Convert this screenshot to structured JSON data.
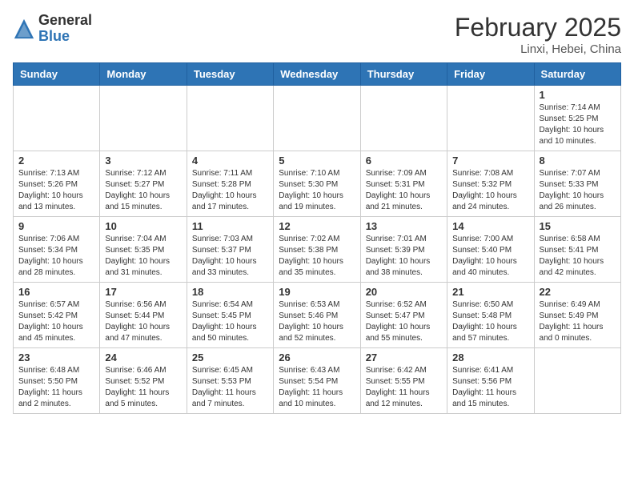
{
  "logo": {
    "general": "General",
    "blue": "Blue"
  },
  "title": {
    "month_year": "February 2025",
    "location": "Linxi, Hebei, China"
  },
  "weekdays": [
    "Sunday",
    "Monday",
    "Tuesday",
    "Wednesday",
    "Thursday",
    "Friday",
    "Saturday"
  ],
  "weeks": [
    [
      {
        "day": "",
        "info": ""
      },
      {
        "day": "",
        "info": ""
      },
      {
        "day": "",
        "info": ""
      },
      {
        "day": "",
        "info": ""
      },
      {
        "day": "",
        "info": ""
      },
      {
        "day": "",
        "info": ""
      },
      {
        "day": "1",
        "info": "Sunrise: 7:14 AM\nSunset: 5:25 PM\nDaylight: 10 hours\nand 10 minutes."
      }
    ],
    [
      {
        "day": "2",
        "info": "Sunrise: 7:13 AM\nSunset: 5:26 PM\nDaylight: 10 hours\nand 13 minutes."
      },
      {
        "day": "3",
        "info": "Sunrise: 7:12 AM\nSunset: 5:27 PM\nDaylight: 10 hours\nand 15 minutes."
      },
      {
        "day": "4",
        "info": "Sunrise: 7:11 AM\nSunset: 5:28 PM\nDaylight: 10 hours\nand 17 minutes."
      },
      {
        "day": "5",
        "info": "Sunrise: 7:10 AM\nSunset: 5:30 PM\nDaylight: 10 hours\nand 19 minutes."
      },
      {
        "day": "6",
        "info": "Sunrise: 7:09 AM\nSunset: 5:31 PM\nDaylight: 10 hours\nand 21 minutes."
      },
      {
        "day": "7",
        "info": "Sunrise: 7:08 AM\nSunset: 5:32 PM\nDaylight: 10 hours\nand 24 minutes."
      },
      {
        "day": "8",
        "info": "Sunrise: 7:07 AM\nSunset: 5:33 PM\nDaylight: 10 hours\nand 26 minutes."
      }
    ],
    [
      {
        "day": "9",
        "info": "Sunrise: 7:06 AM\nSunset: 5:34 PM\nDaylight: 10 hours\nand 28 minutes."
      },
      {
        "day": "10",
        "info": "Sunrise: 7:04 AM\nSunset: 5:35 PM\nDaylight: 10 hours\nand 31 minutes."
      },
      {
        "day": "11",
        "info": "Sunrise: 7:03 AM\nSunset: 5:37 PM\nDaylight: 10 hours\nand 33 minutes."
      },
      {
        "day": "12",
        "info": "Sunrise: 7:02 AM\nSunset: 5:38 PM\nDaylight: 10 hours\nand 35 minutes."
      },
      {
        "day": "13",
        "info": "Sunrise: 7:01 AM\nSunset: 5:39 PM\nDaylight: 10 hours\nand 38 minutes."
      },
      {
        "day": "14",
        "info": "Sunrise: 7:00 AM\nSunset: 5:40 PM\nDaylight: 10 hours\nand 40 minutes."
      },
      {
        "day": "15",
        "info": "Sunrise: 6:58 AM\nSunset: 5:41 PM\nDaylight: 10 hours\nand 42 minutes."
      }
    ],
    [
      {
        "day": "16",
        "info": "Sunrise: 6:57 AM\nSunset: 5:42 PM\nDaylight: 10 hours\nand 45 minutes."
      },
      {
        "day": "17",
        "info": "Sunrise: 6:56 AM\nSunset: 5:44 PM\nDaylight: 10 hours\nand 47 minutes."
      },
      {
        "day": "18",
        "info": "Sunrise: 6:54 AM\nSunset: 5:45 PM\nDaylight: 10 hours\nand 50 minutes."
      },
      {
        "day": "19",
        "info": "Sunrise: 6:53 AM\nSunset: 5:46 PM\nDaylight: 10 hours\nand 52 minutes."
      },
      {
        "day": "20",
        "info": "Sunrise: 6:52 AM\nSunset: 5:47 PM\nDaylight: 10 hours\nand 55 minutes."
      },
      {
        "day": "21",
        "info": "Sunrise: 6:50 AM\nSunset: 5:48 PM\nDaylight: 10 hours\nand 57 minutes."
      },
      {
        "day": "22",
        "info": "Sunrise: 6:49 AM\nSunset: 5:49 PM\nDaylight: 11 hours\nand 0 minutes."
      }
    ],
    [
      {
        "day": "23",
        "info": "Sunrise: 6:48 AM\nSunset: 5:50 PM\nDaylight: 11 hours\nand 2 minutes."
      },
      {
        "day": "24",
        "info": "Sunrise: 6:46 AM\nSunset: 5:52 PM\nDaylight: 11 hours\nand 5 minutes."
      },
      {
        "day": "25",
        "info": "Sunrise: 6:45 AM\nSunset: 5:53 PM\nDaylight: 11 hours\nand 7 minutes."
      },
      {
        "day": "26",
        "info": "Sunrise: 6:43 AM\nSunset: 5:54 PM\nDaylight: 11 hours\nand 10 minutes."
      },
      {
        "day": "27",
        "info": "Sunrise: 6:42 AM\nSunset: 5:55 PM\nDaylight: 11 hours\nand 12 minutes."
      },
      {
        "day": "28",
        "info": "Sunrise: 6:41 AM\nSunset: 5:56 PM\nDaylight: 11 hours\nand 15 minutes."
      },
      {
        "day": "",
        "info": ""
      }
    ]
  ]
}
